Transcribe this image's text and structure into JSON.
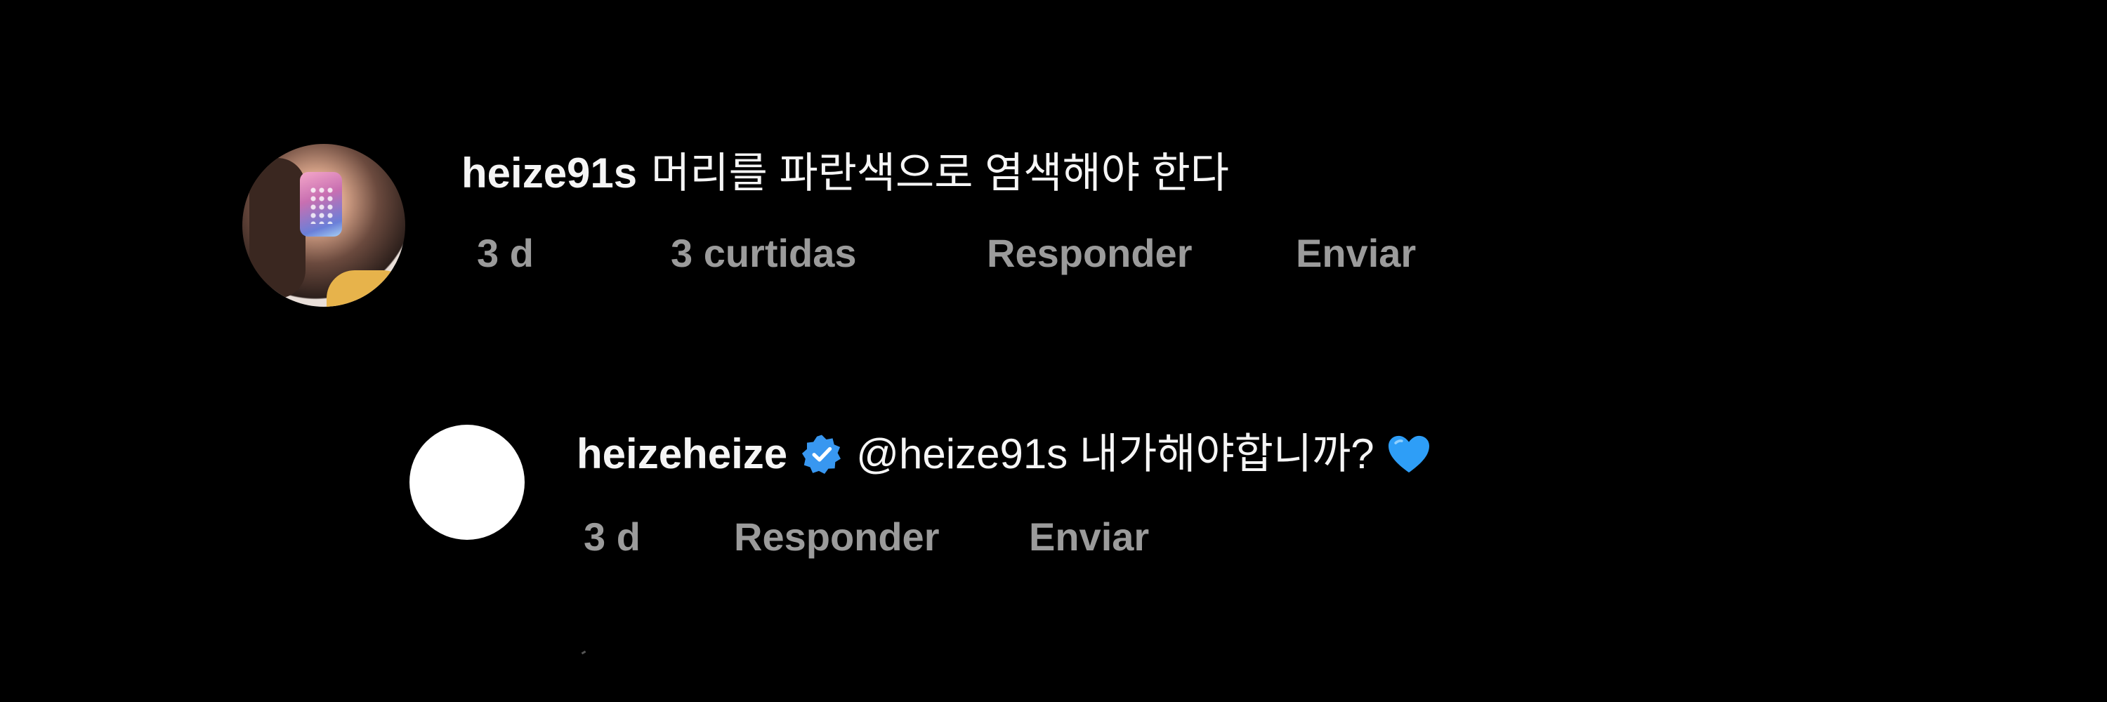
{
  "comments": [
    {
      "username": "heize91s",
      "text": "머리를 파란색으로 염색해야 한다",
      "avatar": "profile-photo",
      "time": "3 d",
      "likes": "3 curtidas",
      "reply": "Responder",
      "send": "Enviar"
    },
    {
      "username": "heizeheize",
      "verified": true,
      "text": "@heize91s 내가해야합니까?",
      "emoji": "blue-heart",
      "avatar": "blank-white",
      "time": "3 d",
      "reply": "Responder",
      "send": "Enviar"
    }
  ],
  "colors": {
    "background": "#000000",
    "primary_text": "#f5f5f5",
    "secondary_text": "#9b9b9b",
    "verified_blue": "#3897f0",
    "heart_blue": "#2e9ef7"
  }
}
